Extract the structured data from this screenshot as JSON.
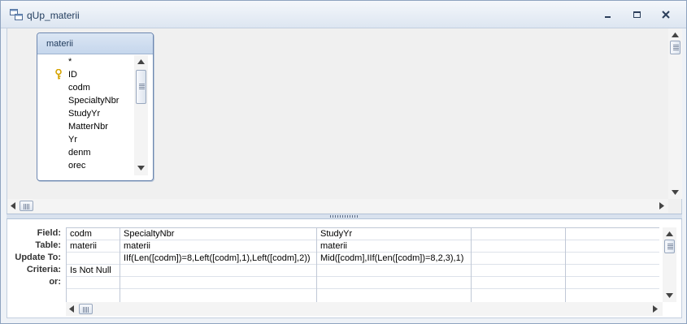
{
  "window": {
    "title": "qUp_materii",
    "icon": "query-icon"
  },
  "table": {
    "name": "materii",
    "fields": [
      {
        "name": "*",
        "primary_key": false
      },
      {
        "name": "ID",
        "primary_key": true
      },
      {
        "name": "codm",
        "primary_key": false
      },
      {
        "name": "SpecialtyNbr",
        "primary_key": false
      },
      {
        "name": "StudyYr",
        "primary_key": false
      },
      {
        "name": "MatterNbr",
        "primary_key": false
      },
      {
        "name": "Yr",
        "primary_key": false
      },
      {
        "name": "denm",
        "primary_key": false
      },
      {
        "name": "orec",
        "primary_key": false
      }
    ]
  },
  "grid": {
    "row_labels": {
      "field": "Field:",
      "table": "Table:",
      "update_to": "Update To:",
      "criteria": "Criteria:",
      "or": "or:"
    },
    "columns": [
      {
        "field": "codm",
        "table": "materii",
        "update_to": "",
        "criteria": "Is Not Null",
        "or": ""
      },
      {
        "field": "SpecialtyNbr",
        "table": "materii",
        "update_to": "IIf(Len([codm])=8,Left([codm],1),Left([codm],2))",
        "criteria": "",
        "or": ""
      },
      {
        "field": "StudyYr",
        "table": "materii",
        "update_to": "Mid([codm],IIf(Len([codm])=8,2,3),1)",
        "criteria": "",
        "or": ""
      },
      {
        "field": "",
        "table": "",
        "update_to": "",
        "criteria": "",
        "or": ""
      },
      {
        "field": "",
        "table": "",
        "update_to": "",
        "criteria": "",
        "or": ""
      }
    ]
  },
  "colors": {
    "title_text": "#1e395b",
    "key_icon": "#d6a300"
  }
}
